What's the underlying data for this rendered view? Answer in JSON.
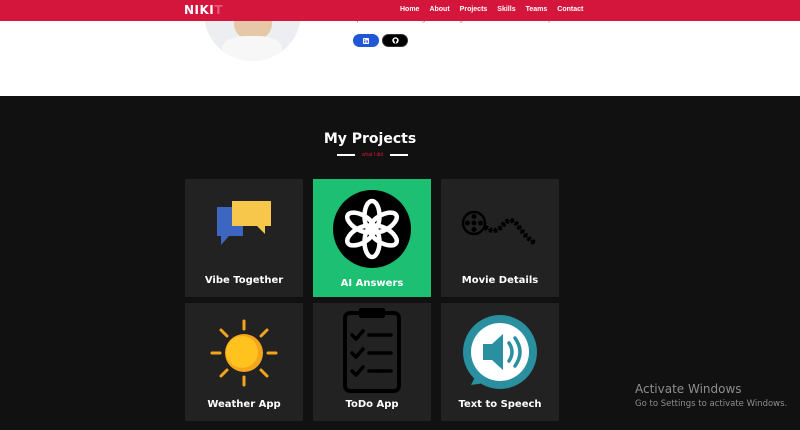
{
  "navbar": {
    "logo_main": "NIKI",
    "logo_faded": "T",
    "links": [
      "Home",
      "About",
      "Projects",
      "Skills",
      "Teams",
      "Contact"
    ]
  },
  "hero": {
    "text": "Apart from these technologies that I am good at are C++ Solid and React.js."
  },
  "projects": {
    "title": "My Projects",
    "subtitle": "what I did",
    "cards": [
      {
        "label": "Vibe Together",
        "icon": "chat-bubbles-icon"
      },
      {
        "label": "AI Answers",
        "icon": "openai-icon"
      },
      {
        "label": "Movie Details",
        "icon": "film-reel-icon"
      },
      {
        "label": "Weather App",
        "icon": "sun-icon"
      },
      {
        "label": "ToDo App",
        "icon": "clipboard-checklist-icon"
      },
      {
        "label": "Text to Speech",
        "icon": "speaker-icon"
      }
    ]
  },
  "watermark": {
    "title": "Activate Windows",
    "subtitle": "Go to Settings to activate Windows."
  },
  "colors": {
    "navbar": "#d4163c",
    "active_card": "#1dbf73",
    "card": "#222222",
    "background": "#111111"
  }
}
